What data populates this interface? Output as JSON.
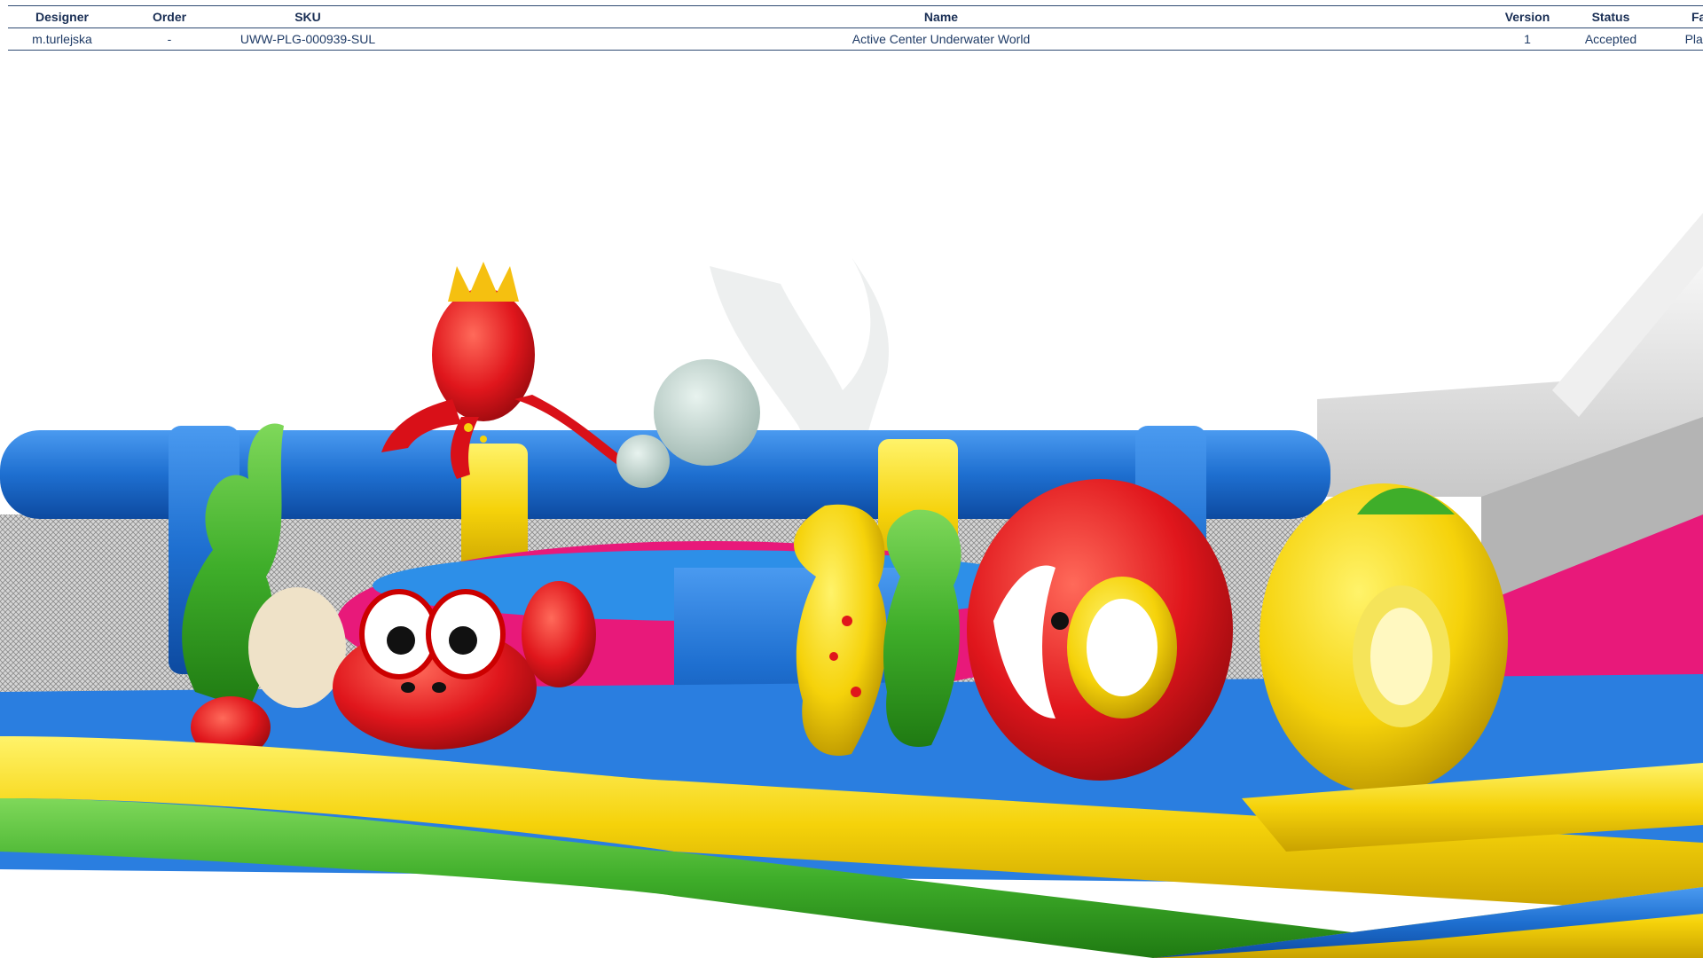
{
  "table": {
    "headers": {
      "designer": "Designer",
      "order": "Order",
      "sku": "SKU",
      "name": "Name",
      "version": "Version",
      "status": "Status",
      "fabric": "Fabric"
    },
    "row": {
      "designer": "m.turlejska",
      "order": "-",
      "sku": "UWW-PLG-000939-SUL",
      "name": "Active Center Underwater World",
      "version": "1",
      "status": "Accepted",
      "fabric": "Plasicota"
    }
  },
  "colors": {
    "blue": "#1e6fd0",
    "yellow": "#f5d20a",
    "green": "#3fae2a",
    "red": "#e0161c",
    "pink": "#e8197a",
    "header_text": "#1a2f55"
  }
}
